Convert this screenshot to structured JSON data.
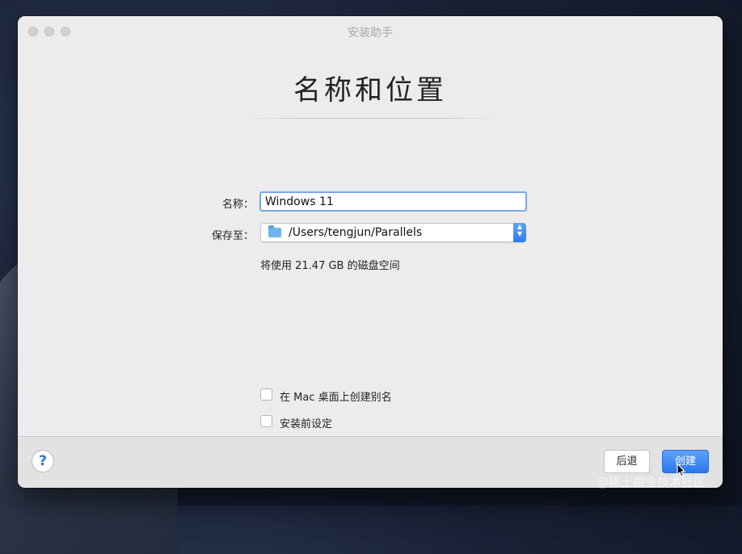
{
  "window": {
    "title": "安装助手"
  },
  "page": {
    "heading": "名称和位置"
  },
  "form": {
    "name_label": "名称：",
    "name_value": "Windows 11",
    "location_label": "保存至：",
    "location_value": "/Users/tengjun/Parallels",
    "disk_usage": "将使用 21.47 GB 的磁盘空间"
  },
  "options": [
    {
      "label": "在 Mac 桌面上创建别名",
      "checked": false
    },
    {
      "label": "安装前设定",
      "checked": false
    }
  ],
  "footer": {
    "help_label": "?",
    "back_label": "后退",
    "create_label": "创建"
  },
  "watermark": "@稀土掘金技术社区",
  "colors": {
    "accent": "#2f7cef",
    "focus_ring": "#7aa7e6",
    "folder": "#6eb4f0"
  }
}
